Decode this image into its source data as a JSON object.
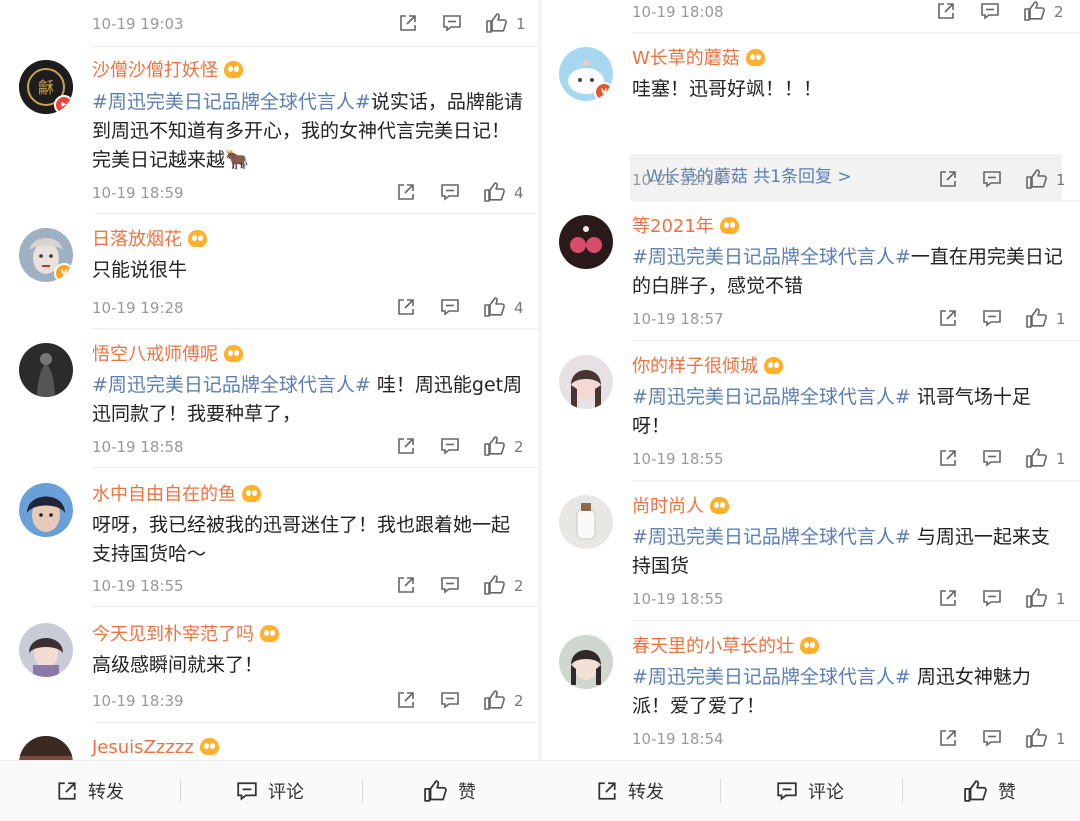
{
  "colors": {
    "username": "#eb7340",
    "topic": "#5b7fb2",
    "time": "#999999",
    "text": "#222222",
    "vip": "#ffb12e"
  },
  "left_comments": [
    {
      "time": "10-19 19:03",
      "likes": "1"
    },
    {
      "name": "沙僧沙僧打妖怪",
      "topic": "#周迅完美日记品牌全球代言人#",
      "text_after": "说实话，品牌能请到周迅不知道有多开心，我的女神代言完美日记！完美日记越来越🐂",
      "time": "10-19 18:59",
      "likes": "4"
    },
    {
      "name": "日落放烟花",
      "topic": "",
      "text_after": "只能说很牛",
      "time": "10-19 19:28",
      "likes": "4"
    },
    {
      "name": "悟空八戒师傅呢",
      "topic": "#周迅完美日记品牌全球代言人#",
      "text_after": "哇！周迅能get周迅同款了！我要种草了，",
      "time": "10-19 18:58",
      "likes": "2"
    },
    {
      "name": "水中自由自在的鱼",
      "topic": "",
      "text_after": "呀呀，我已经被我的迅哥迷住了！我也跟着她一起支持国货哈～",
      "time": "10-19 18:55",
      "likes": "2"
    },
    {
      "name": "今天见到朴宰范了吗",
      "topic": "",
      "text_after": "高级感瞬间就来了！",
      "time": "10-19 18:39",
      "likes": "2"
    },
    {
      "name": "JesuisZzzzz"
    }
  ],
  "right_comments": [
    {
      "time": "10-19 18:08",
      "likes": "2"
    },
    {
      "name": "W长草的蘑菇",
      "topic": "",
      "text_after": "哇塞！迅哥好飒！！！",
      "reply": "W长草的蘑菇  共1条回复 >",
      "time": "10-21 22:18",
      "likes": "1"
    },
    {
      "name": "等2021年",
      "topic": "#周迅完美日记品牌全球代言人#",
      "text_after": "一直在用完美日记的白胖子，感觉不错",
      "time": "10-19 18:57",
      "likes": "1"
    },
    {
      "name": "你的样子很倾城",
      "topic": "#周迅完美日记品牌全球代言人#",
      "text_after": "讯哥气场十足呀！",
      "time": "10-19 18:55",
      "likes": "1"
    },
    {
      "name": "尚时尚人",
      "topic": "#周迅完美日记品牌全球代言人#",
      "text_after": "与周迅一起来支持国货",
      "time": "10-19 18:55",
      "likes": "1"
    },
    {
      "name": "春天里的小草长的壮",
      "topic": "#周迅完美日记品牌全球代言人#",
      "text_after": "周迅女神魅力派！爱了爱了！",
      "time": "10-19 18:54",
      "likes": "1"
    }
  ],
  "bottom_bar": {
    "repost": "转发",
    "comment": "评论",
    "like": "赞"
  },
  "icons": {
    "share": "share-icon",
    "comment": "comment-icon",
    "like": "thumbs-up-icon",
    "vip": "vip-crown-icon"
  }
}
